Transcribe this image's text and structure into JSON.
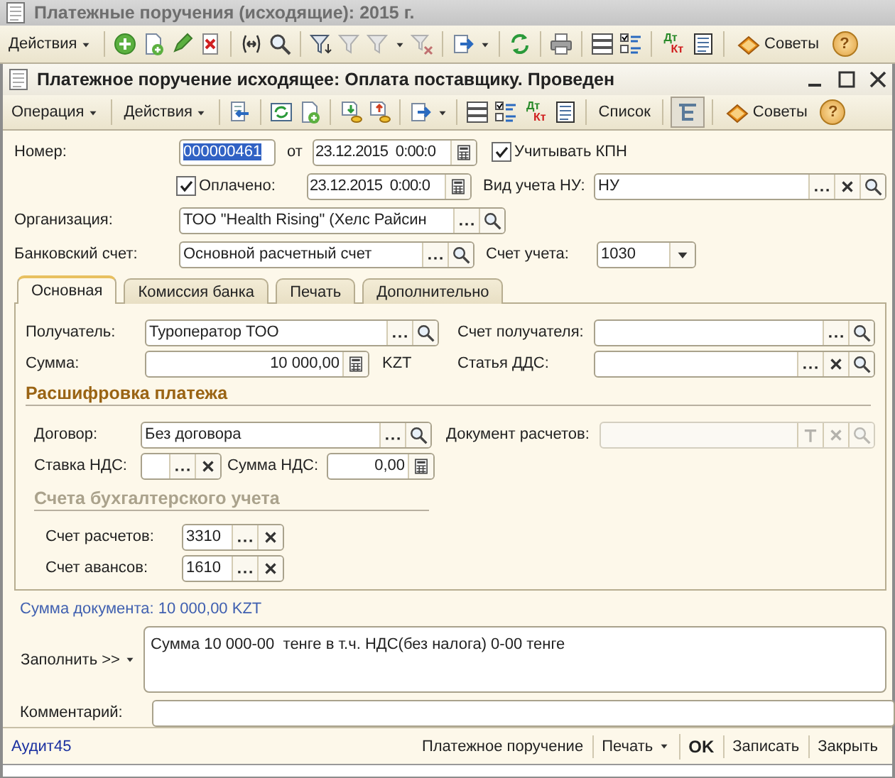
{
  "list_window": {
    "title": "Платежные поручения (исходящие): 2015 г.",
    "actions_menu": "Действия",
    "ledger_icon": {
      "top": "Дт",
      "bottom": "Кт"
    },
    "tips_button": "Советы",
    "help_button": "?"
  },
  "document_window": {
    "title": "Платежное поручение исходящее: Оплата поставщику. Проведен",
    "operation_menu": "Операция",
    "actions_menu": "Действия",
    "ledger_icon": {
      "top": "Дт",
      "bottom": "Кт"
    },
    "list_button": "Список",
    "tips_button": "Советы",
    "help_button": "?"
  },
  "header": {
    "number": {
      "label": "Номер:",
      "value": "000000461",
      "highlighted": true
    },
    "date": {
      "label": "от",
      "value": "23.12.2015  0:00:0"
    },
    "consider_cit": {
      "label": "Учитывать КПН",
      "checked": true
    },
    "paid": {
      "label": "Оплачено:",
      "checked": true
    },
    "paid_date": {
      "value": "23.12.2015  0:00:0"
    },
    "tax_accounting_type": {
      "label": "Вид учета НУ:",
      "value": "НУ"
    },
    "organization": {
      "label": "Организация:",
      "value": "ТОО \"Health Rising\" (Хелс Райсин"
    },
    "bank_account": {
      "label": "Банковский счет:",
      "value": "Основной расчетный счет"
    },
    "account": {
      "label": "Счет учета:",
      "value": "1030"
    }
  },
  "tabs": [
    {
      "label": "Основная",
      "selected": true
    },
    {
      "label": "Комиссия банка",
      "selected": false
    },
    {
      "label": "Печать",
      "selected": false
    },
    {
      "label": "Дополнительно",
      "selected": false
    }
  ],
  "main_tab": {
    "recipient": {
      "label": "Получатель:",
      "value": "Туроператор ТОО"
    },
    "recipient_account": {
      "label": "Счет получателя:"
    },
    "amount": {
      "label": "Сумма:",
      "value": "10 000,00",
      "currency": "KZT"
    },
    "cash_flow_item": {
      "label": "Статья ДДС:"
    },
    "breakdown_title": "Расшифровка платежа",
    "contract": {
      "label": "Договор:",
      "value": "Без договора"
    },
    "settlement_document": {
      "label": "Документ расчетов:",
      "disabled": true
    },
    "vat_rate": {
      "label": "Ставка НДС:"
    },
    "vat_amount": {
      "label": "Сумма НДС:",
      "value": "0,00"
    },
    "accounts_title": "Счета бухгалтерского учета",
    "settlement_account": {
      "label": "Счет расчетов:",
      "value": "3310"
    },
    "advance_account": {
      "label": "Счет авансов:",
      "value": "1610"
    }
  },
  "document_total": "Сумма документа: 10 000,00 KZT",
  "purpose": {
    "fill_button": "Заполнить >>",
    "value": "Сумма 10 000-00  тенге в т.ч. НДС(без налога) 0-00 тенге"
  },
  "comment": {
    "label": "Комментарий:"
  },
  "footer": {
    "author": "Аудит45",
    "buttons": [
      {
        "label": "Платежное поручение",
        "kind": "plain"
      },
      {
        "label": "Печать",
        "kind": "menu"
      },
      {
        "label": "OK",
        "kind": "default"
      },
      {
        "label": "Записать",
        "kind": "plain"
      },
      {
        "label": "Закрыть",
        "kind": "plain"
      }
    ]
  }
}
